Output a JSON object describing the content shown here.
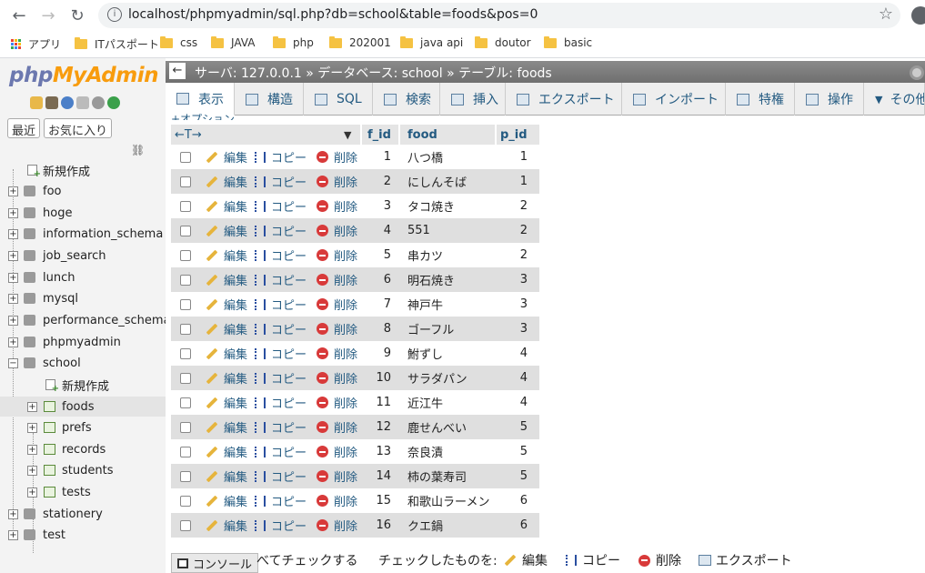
{
  "browser": {
    "url": "localhost/phpmyadmin/sql.php?db=school&table=foods&pos=0",
    "bookmarks": [
      "アプリ",
      "ITパスポート",
      "css",
      "JAVA",
      "php",
      "202001",
      "java api",
      "doutor",
      "basic"
    ]
  },
  "sidebar": {
    "logo_php": "php",
    "logo_myadmin": "MyAdmin",
    "tab_recent": "最近",
    "tab_favorites": "お気に入り",
    "items": [
      {
        "label": "新規作成"
      },
      {
        "label": "foo"
      },
      {
        "label": "hoge"
      },
      {
        "label": "information_schema"
      },
      {
        "label": "job_search"
      },
      {
        "label": "lunch"
      },
      {
        "label": "mysql"
      },
      {
        "label": "performance_schema"
      },
      {
        "label": "phpmyadmin"
      },
      {
        "label": "school"
      },
      {
        "label": "新規作成"
      },
      {
        "label": "foods"
      },
      {
        "label": "prefs"
      },
      {
        "label": "records"
      },
      {
        "label": "students"
      },
      {
        "label": "tests"
      },
      {
        "label": "stationery"
      },
      {
        "label": "test"
      }
    ]
  },
  "breadcrumb": {
    "server": "サーバ: 127.0.0.1",
    "database": "データベース: school",
    "table": "テーブル: foods"
  },
  "tabs": [
    "表示",
    "構造",
    "SQL",
    "検索",
    "挿入",
    "エクスポート",
    "インポート",
    "特権",
    "操作",
    "その他"
  ],
  "grid": {
    "options_label": "+オプション",
    "arrows": "←T→",
    "columns": [
      "f_id",
      "food",
      "p_id"
    ],
    "actions": {
      "edit": "編集",
      "copy": "コピー",
      "delete": "削除"
    },
    "rows": [
      {
        "f_id": "1",
        "food": "八つ橋",
        "p_id": "1"
      },
      {
        "f_id": "2",
        "food": "にしんそば",
        "p_id": "1"
      },
      {
        "f_id": "3",
        "food": "タコ焼き",
        "p_id": "2"
      },
      {
        "f_id": "4",
        "food": "551",
        "p_id": "2"
      },
      {
        "f_id": "5",
        "food": "串カツ",
        "p_id": "2"
      },
      {
        "f_id": "6",
        "food": "明石焼き",
        "p_id": "3"
      },
      {
        "f_id": "7",
        "food": "神戸牛",
        "p_id": "3"
      },
      {
        "f_id": "8",
        "food": "ゴーフル",
        "p_id": "3"
      },
      {
        "f_id": "9",
        "food": "鮒ずし",
        "p_id": "4"
      },
      {
        "f_id": "10",
        "food": "サラダパン",
        "p_id": "4"
      },
      {
        "f_id": "11",
        "food": "近江牛",
        "p_id": "4"
      },
      {
        "f_id": "12",
        "food": "鹿せんべい",
        "p_id": "5"
      },
      {
        "f_id": "13",
        "food": "奈良漬",
        "p_id": "5"
      },
      {
        "f_id": "14",
        "food": "柿の葉寿司",
        "p_id": "5"
      },
      {
        "f_id": "15",
        "food": "和歌山ラーメン",
        "p_id": "6"
      },
      {
        "f_id": "16",
        "food": "クエ鍋",
        "p_id": "6"
      }
    ]
  },
  "footer": {
    "console": "コンソール",
    "check_all": "べてチェックする",
    "with_selected": "チェックしたものを:",
    "edit": "編集",
    "copy": "コピー",
    "delete": "削除",
    "export": "エクスポート"
  }
}
